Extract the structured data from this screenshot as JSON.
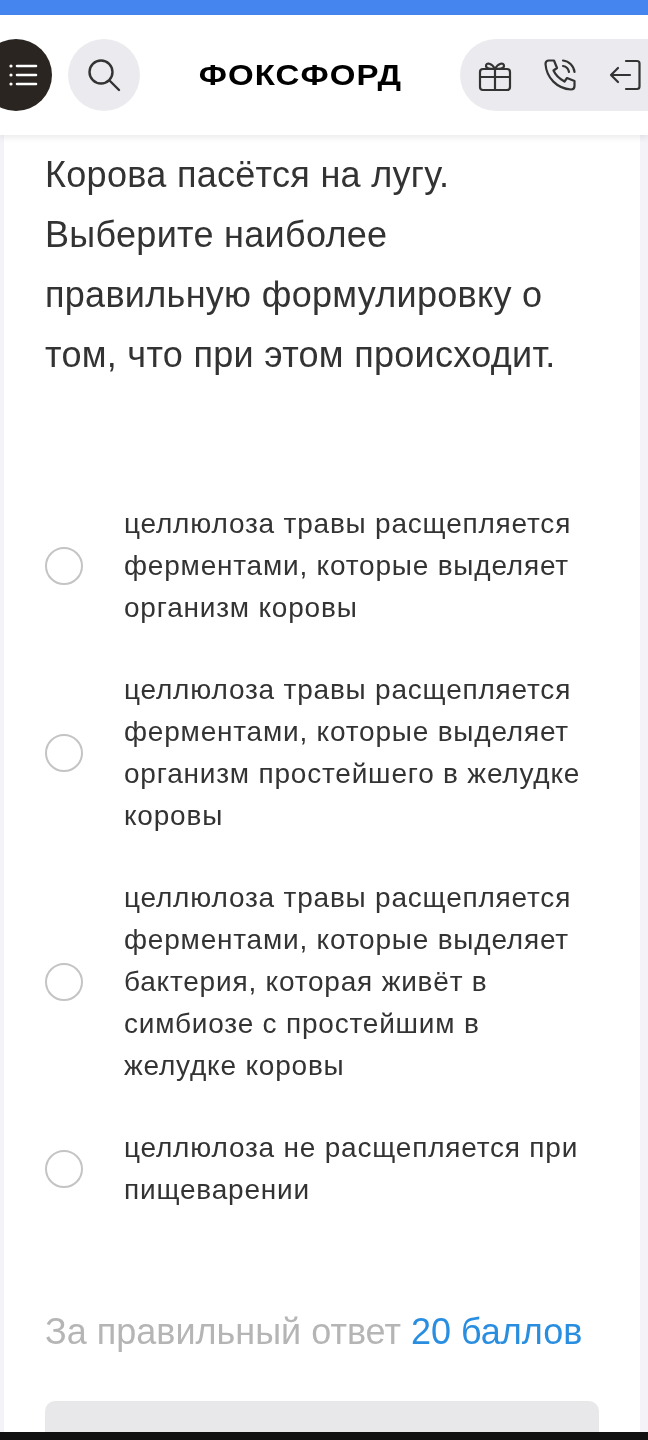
{
  "header": {
    "logo": "ФОКСФОРД"
  },
  "question": {
    "text": "Корова пасётся на лугу. Выберите наиболее правильную формулировку о том, что при этом происходит."
  },
  "options": [
    {
      "text": "целлюлоза травы расщепляется ферментами, которые выделяет организм коровы",
      "selected": false
    },
    {
      "text": "целлюлоза травы расщепляется ферментами, которые выделяет организм простейшего в желудке коровы",
      "selected": false
    },
    {
      "text": "целлюлоза травы расщепляется ферментами, которые выделяет бактерия, которая живёт в симбиозе с простейшим в желудке коровы",
      "selected": false
    },
    {
      "text": "целлюлоза не расщепляется при пищеварении",
      "selected": false
    }
  ],
  "reward": {
    "label": "За правильный ответ",
    "points": "20 баллов"
  }
}
